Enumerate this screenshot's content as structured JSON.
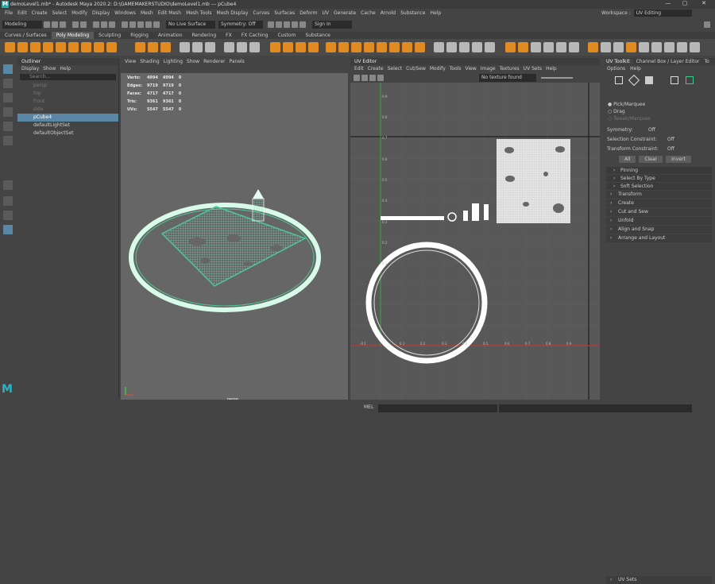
{
  "titlebar": {
    "title": "demoLevel1.mb* - Autodesk Maya 2020.2: D:\\GAMEMAKERSTUDIO\\demoLevel1.mb   ---   pCube4",
    "minimize": "—",
    "maximize": "▢",
    "close": "✕"
  },
  "menubar": [
    "File",
    "Edit",
    "Create",
    "Select",
    "Modify",
    "Display",
    "Windows",
    "Mesh",
    "Edit Mesh",
    "Mesh Tools",
    "Mesh Display",
    "Curves",
    "Surfaces",
    "Deform",
    "UV",
    "Generate",
    "Cache",
    "Arnold",
    "Substance",
    "Help"
  ],
  "workspace": {
    "label": "Workspace :",
    "value": "UV Editing"
  },
  "statusline": {
    "mode": "Modeling",
    "live": "No Live Surface",
    "symmetry": "Symmetry: Off",
    "signin": "Sign In"
  },
  "shelf_tabs": [
    "Curves / Surfaces",
    "Poly Modeling",
    "Sculpting",
    "Rigging",
    "Animation",
    "Rendering",
    "FX",
    "FX Caching",
    "Custom",
    "Substance"
  ],
  "active_shelf_tab": "Poly Modeling",
  "outliner": {
    "title": "Outliner",
    "menus": [
      "Display",
      "Show",
      "Help"
    ],
    "search_placeholder": "Search...",
    "items": [
      {
        "label": "persp",
        "dim": true
      },
      {
        "label": "top",
        "dim": true
      },
      {
        "label": "front",
        "dim": true
      },
      {
        "label": "side",
        "dim": true
      },
      {
        "label": "pCube4",
        "selected": true
      },
      {
        "label": "defaultLightSet"
      },
      {
        "label": "defaultObjectSet"
      }
    ]
  },
  "viewport": {
    "menus": [
      "View",
      "Shading",
      "Lighting",
      "Show",
      "Renderer",
      "Panels"
    ],
    "hud": [
      {
        "label": "Verts:",
        "a": "4994",
        "b": "4994",
        "c": "0"
      },
      {
        "label": "Edges:",
        "a": "9719",
        "b": "9719",
        "c": "0"
      },
      {
        "label": "Faces:",
        "a": "4717",
        "b": "4717",
        "c": "0"
      },
      {
        "label": "Tris:",
        "a": "9361",
        "b": "9361",
        "c": "0"
      },
      {
        "label": "UVs:",
        "a": "5547",
        "b": "5547",
        "c": "0"
      }
    ],
    "camera": "persp"
  },
  "uv_editor": {
    "title": "UV Editor",
    "menus": [
      "Edit",
      "Create",
      "Select",
      "Cut/Sew",
      "Modify",
      "Tools",
      "View",
      "Image",
      "Textures",
      "UV Sets",
      "Help"
    ],
    "texture_status": "No texture found",
    "y_ticks": [
      "0.9",
      "0.8",
      "0.7",
      "0.6",
      "0.5",
      "0.4",
      "0.3",
      "0.2",
      "0.1"
    ],
    "x_ticks": [
      "0.1",
      "0.2",
      "0.3",
      "0.4",
      "0.5",
      "0.6",
      "0.7",
      "0.8",
      "0.9"
    ],
    "origin_label": "-0.1"
  },
  "uv_toolkit": {
    "tabs": [
      "UV Toolkit",
      "Channel Box / Layer Editor",
      "To"
    ],
    "menus": [
      "Options",
      "Help"
    ],
    "modes": [
      {
        "label": "Pick/Marquee",
        "checked": true
      },
      {
        "label": "Drag",
        "checked": false
      },
      {
        "label": "Tweak/Marquee",
        "checked": false,
        "dim": true
      }
    ],
    "symmetry": {
      "label": "Symmetry:",
      "value": "Off"
    },
    "selection_constraint": {
      "label": "Selection Constraint:",
      "value": "Off"
    },
    "transform_constraint": {
      "label": "Transform Constraint:",
      "value": "Off"
    },
    "buttons": [
      "All",
      "Clear",
      "Invert"
    ],
    "subsections": [
      "Pinning",
      "Select By Type",
      "Soft Selection"
    ],
    "sections": [
      "Transform",
      "Create",
      "Cut and Sew",
      "Unfold",
      "Align and Snap",
      "Arrange and Layout"
    ],
    "uv_sets": "UV Sets"
  },
  "commandline": {
    "label": "MEL"
  }
}
